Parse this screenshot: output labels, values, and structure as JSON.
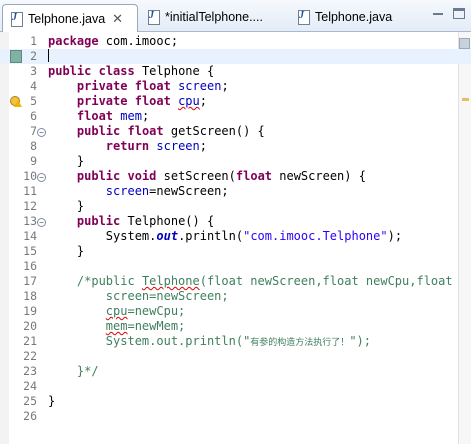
{
  "tabs": [
    {
      "label": "Telphone.java",
      "close": "✕",
      "active": true
    },
    {
      "label": "*initialTelphone....",
      "active": false
    },
    {
      "label": "Telphone.java",
      "active": false
    }
  ],
  "code_lines": [
    {
      "n": "1"
    },
    {
      "n": "2"
    },
    {
      "n": "3"
    },
    {
      "n": "4"
    },
    {
      "n": "5"
    },
    {
      "n": "6"
    },
    {
      "n": "7"
    },
    {
      "n": "8"
    },
    {
      "n": "9"
    },
    {
      "n": "10"
    },
    {
      "n": "11"
    },
    {
      "n": "12"
    },
    {
      "n": "13"
    },
    {
      "n": "14"
    },
    {
      "n": "15"
    },
    {
      "n": "16"
    },
    {
      "n": "17"
    },
    {
      "n": "18"
    },
    {
      "n": "19"
    },
    {
      "n": "20"
    },
    {
      "n": "21"
    },
    {
      "n": "22"
    },
    {
      "n": "23"
    },
    {
      "n": "24"
    },
    {
      "n": "25"
    },
    {
      "n": "26"
    }
  ],
  "code": {
    "l1": {
      "kw": "package",
      "rest": " com.imooc;"
    },
    "l3": {
      "kw1": "public",
      "kw2": "class",
      "rest": " Telphone {"
    },
    "l4": {
      "kw1": "private",
      "kw2": "float",
      "fld": "screen",
      "end": ";"
    },
    "l5": {
      "kw1": "private",
      "kw2": "float",
      "fld": "cpu",
      "end": ";"
    },
    "l6": {
      "kw": "float",
      "fld": "mem",
      "end": ";"
    },
    "l7": {
      "kw1": "public",
      "kw2": "float",
      "rest": " getScreen() {"
    },
    "l8": {
      "kw": "return",
      "fld": "screen",
      "end": ";"
    },
    "l9": "}",
    "l10": {
      "kw1": "public",
      "kw2": "void",
      "mid": " setScreen(",
      "kw3": "float",
      "rest": " newScreen) {"
    },
    "l11": {
      "fld": "screen",
      "rest": "=newScreen;"
    },
    "l12": "}",
    "l13": {
      "kw": "public",
      "rest": " Telphone() {"
    },
    "l14": {
      "a": "System.",
      "sfld": "out",
      "b": ".println(",
      "str": "\"com.imooc.Telphone\"",
      "c": ");"
    },
    "l15": "}",
    "l17": {
      "a": "/*public ",
      "sq": "Telphone",
      "b": "(float newScreen,float newCpu,float"
    },
    "l18": "screen=newScreen;",
    "l19": {
      "sq": "cpu",
      "b": "=newCpu;"
    },
    "l20": {
      "sq": "mem",
      "b": "=newMem;"
    },
    "l21": {
      "a": "System.out.println(\"",
      "cn": "有参的构造方法执行了！",
      "b": "\");"
    },
    "l23": "}*/",
    "l25": "}"
  }
}
